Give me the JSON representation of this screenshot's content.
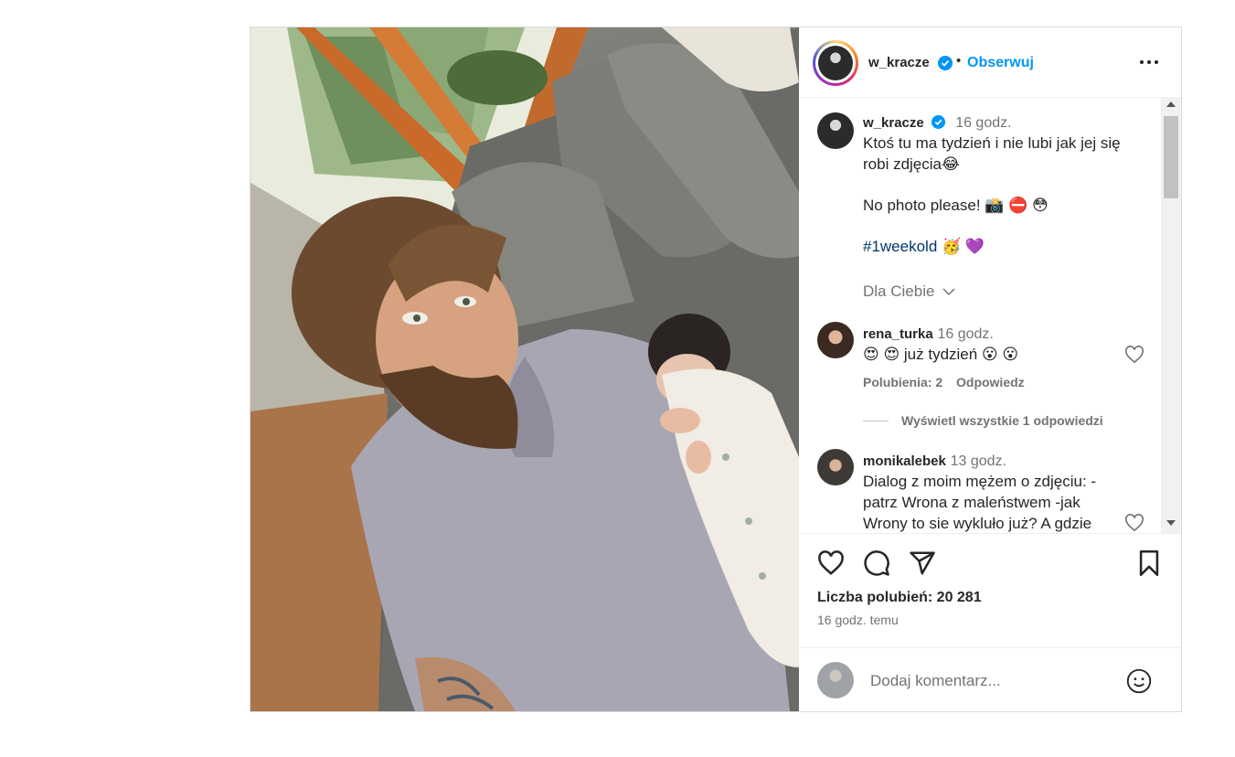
{
  "post": {
    "header": {
      "username": "w_kracze",
      "separator": "•",
      "follow_label": "Obserwuj"
    },
    "caption": {
      "username": "w_kracze",
      "time": "16 godz.",
      "line1": "Ktoś tu ma tydzień i nie lubi jak jej się",
      "line2": "robi zdjęcia😂",
      "line3": "No photo please! 📸 ⛔ 😳",
      "hashtag": "#1weekold",
      "hashtag_suffix": " 🥳 💜",
      "dla_ciebie": "Dla Ciebie"
    },
    "comments": [
      {
        "username": "rena_turka",
        "time": "16 godz.",
        "text": "😍 😍 już tydzień 😮 😮",
        "likes_label": "Polubienia: 2",
        "reply_label": "Odpowiedz",
        "view_replies_label": "Wyświetl wszystkie 1 odpowiedzi"
      },
      {
        "username": "monikalebek",
        "time": "13 godz.",
        "line1": "Dialog z moim mężem o zdjęciu: -",
        "line2": "patrz Wrona z maleństwem -jak",
        "line3": "Wrony to sie wykluło już? A gdzie"
      }
    ],
    "likes_label": "Liczba polubień: 20 281",
    "time_ago": "16 godz. temu",
    "add_comment_placeholder": "Dodaj komentarz...",
    "colors": {
      "follow_blue": "#0095f6",
      "verified_blue": "#0095f6",
      "hashtag": "#00376b",
      "muted": "#737373"
    },
    "icons": [
      "verified-badge-icon",
      "more-options-icon",
      "heart-icon",
      "comment-icon",
      "share-icon",
      "bookmark-icon",
      "emoji-icon",
      "chevron-down-icon"
    ]
  }
}
